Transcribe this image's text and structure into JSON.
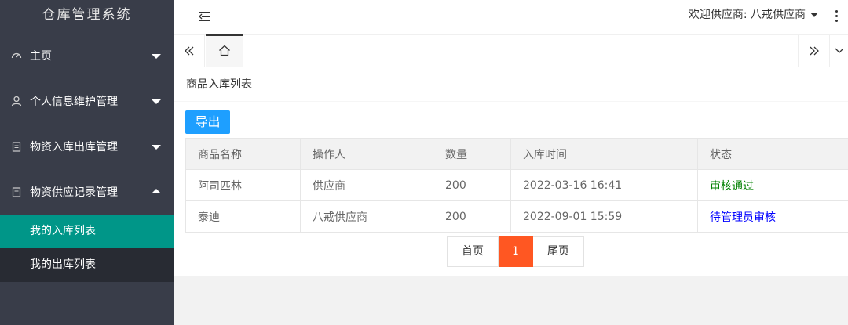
{
  "app": {
    "title": "仓库管理系统"
  },
  "sidebar": {
    "groups": [
      {
        "label": "主页",
        "icon": "dashboard-icon",
        "expanded": false
      },
      {
        "label": "个人信息维护管理",
        "icon": "user-icon",
        "expanded": false
      },
      {
        "label": "物资入库出库管理",
        "icon": "document-icon",
        "expanded": false
      },
      {
        "label": "物资供应记录管理",
        "icon": "document-icon",
        "expanded": true
      }
    ],
    "sub_items": [
      {
        "label": "我的入库列表",
        "active": true
      },
      {
        "label": "我的出库列表",
        "active": false
      }
    ]
  },
  "header": {
    "welcome": "欢迎供应商: 八戒供应商"
  },
  "tabs": {
    "home_icon": "home-icon",
    "prev_icon": "double-chevron-left-icon",
    "next_icon": "double-chevron-right-icon",
    "dropdown_icon": "chevron-down-icon"
  },
  "page": {
    "title": "商品入库列表",
    "export_label": "导出"
  },
  "table": {
    "columns": [
      "商品名称",
      "操作人",
      "数量",
      "入库时间",
      "状态"
    ],
    "rows": [
      {
        "cells": [
          "阿司匹林",
          "供应商",
          "200",
          "2022-03-16 16:41",
          "审核通过"
        ],
        "status_color": "#008000"
      },
      {
        "cells": [
          "泰迪",
          "八戒供应商",
          "200",
          "2022-09-01 15:59",
          "待管理员审核"
        ],
        "status_color": "#0000ff"
      }
    ]
  },
  "pagination": {
    "first_label": "首页",
    "current_page": "1",
    "last_label": "尾页"
  },
  "colors": {
    "sidebar_bg": "#393d49",
    "active_item": "#009688",
    "export_button": "#1e9fff",
    "current_page": "#ff5722"
  }
}
